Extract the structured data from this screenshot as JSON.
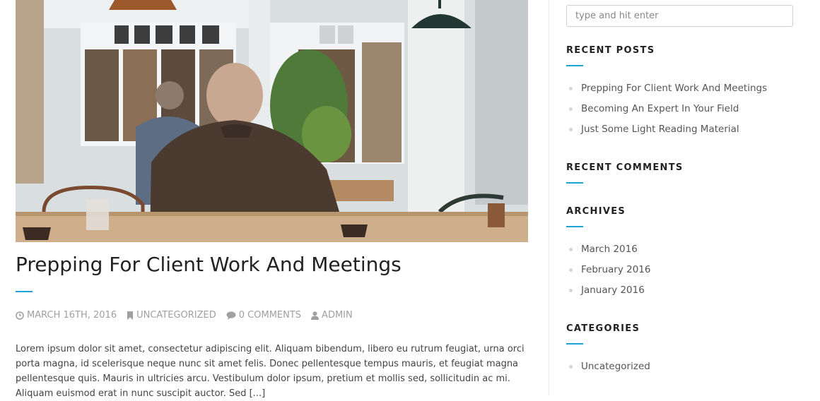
{
  "post": {
    "title": "Prepping For Client Work And Meetings",
    "meta": {
      "date": "MARCH 16TH, 2016",
      "category": "UNCATEGORIZED",
      "comments": "0 COMMENTS",
      "author": "ADMIN"
    },
    "excerpt": "Lorem ipsum dolor sit amet, consectetur adipiscing elit. Aliquam bibendum, libero eu rutrum feugiat, urna orci porta magna, id scelerisque neque nunc sit amet felis. Donec pellentesque tempus mauris, et feugiat magna pellentesque quis. Mauris in ultricies arcu. Vestibulum dolor ipsum, pretium et mollis sed, sollicitudin ac mi. Aliquam euismod erat in nunc suscipit auctor. Sed [...]"
  },
  "sidebar": {
    "search": {
      "placeholder": "type and hit enter"
    },
    "recent_posts": {
      "title": "RECENT POSTS",
      "items": [
        "Prepping For Client Work And Meetings",
        "Becoming An Expert In Your Field",
        "Just Some Light Reading Material"
      ]
    },
    "recent_comments": {
      "title": "RECENT COMMENTS"
    },
    "archives": {
      "title": "ARCHIVES",
      "items": [
        "March 2016",
        "February 2016",
        "January 2016"
      ]
    },
    "categories": {
      "title": "CATEGORIES",
      "items": [
        "Uncategorized"
      ]
    }
  },
  "icons": {
    "date": "clock-icon",
    "category": "bookmark-icon",
    "comments": "comment-icon",
    "author": "user-icon"
  },
  "colors": {
    "accent": "#1aa3d4",
    "meta_text": "#a0a0a0",
    "title_text": "#222222"
  }
}
